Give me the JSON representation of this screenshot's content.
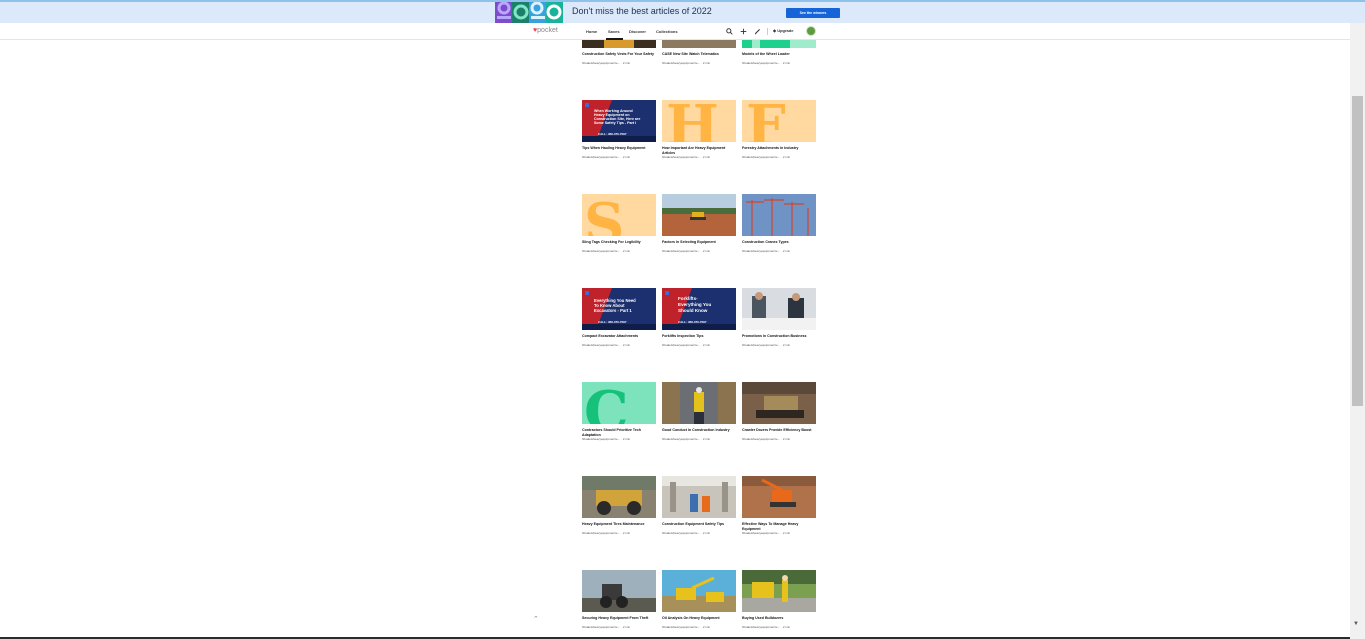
{
  "banner": {
    "text": "Don't miss the best articles of 2022",
    "button_label": "See the winners",
    "art_text": "2022"
  },
  "nav": {
    "logo_mark": "♥",
    "logo_text": "pocket",
    "items": [
      "Home",
      "Saves",
      "Discover",
      "Collections"
    ],
    "active_item": "Saves",
    "upgrade_label": "Upgrade"
  },
  "cards": [
    {
      "title": "Construction Safety Vests For Your Safety",
      "meta": "hbsaleisheavyequipmentre... · 2 min"
    },
    {
      "title": "CASE New Site Watch Telematics",
      "meta": "hbsaleisheavyequipmentre... · 2 min"
    },
    {
      "title": "Models of the Wheel Loader",
      "meta": "hbsaleisheavyequipmentre... · 2 min"
    },
    {
      "title": "Tips When Hauling Heavy Equipment",
      "meta": "hbsaleisheavyequipmentre... · 2 min"
    },
    {
      "title": "How Important Are Heavy Equipment Articles",
      "meta": "hbsaleisheavyequipmentre... · 2 min"
    },
    {
      "title": "Forestry Attachments In Industry",
      "meta": "hbsaleisheavyequipmentre... · 2 min"
    },
    {
      "title": "Sling Tags Checking For Legibility",
      "meta": "hbsaleisheavyequipmentre... · 2 min"
    },
    {
      "title": "Factors In Selecting Equipment",
      "meta": "hbsaleisheavyequipmentre... · 2 min"
    },
    {
      "title": "Construction Cranes Types",
      "meta": "hbsaleisheavyequipmentre... · 2 min"
    },
    {
      "title": "Compact Excavator Attachments",
      "meta": "hbsaleisheavyequipmentre... · 2 min"
    },
    {
      "title": "Forklifts Inspection Tips",
      "meta": "hbsaleisheavyequipmentre... · 2 min"
    },
    {
      "title": "Promotions In Construction Business",
      "meta": "hbsaleisheavyequipmentre... · 2 min"
    },
    {
      "title": "Contractors Should Prioritize Tech Adaptation",
      "meta": "hbsaleisheavyequipmentre... · 2 min"
    },
    {
      "title": "Good Conduct In Construction Industry",
      "meta": "hbsaleisheavyequipmentre... · 2 min"
    },
    {
      "title": "Crawler Dozers Provide Efficiency Boost",
      "meta": "hbsaleisheavyequipmentre... · 2 min"
    },
    {
      "title": "Heavy Equipment Tires Maintenance",
      "meta": "hbsaleisheavyequipmentre... · 2 min"
    },
    {
      "title": "Construction Equipment Safety Tips",
      "meta": "hbsaleisheavyequipmentre... · 2 min"
    },
    {
      "title": "Effective Ways To Manage Heavy Equipment",
      "meta": "hbsaleisheavyequipmentre... · 2 min"
    },
    {
      "title": "Securing Heavy Equipment From Theft",
      "meta": "hbsaleisheavyequipmentre... · 2 min"
    },
    {
      "title": "Oil Analysis On Heavy Equipment",
      "meta": "hbsaleisheavyequipmentre... · 2 min"
    },
    {
      "title": "Buying Used Bulldozers",
      "meta": "hbsaleisheavyequipmentre... · 2 min"
    }
  ],
  "thumb_text": {
    "t3": [
      "When Working Around",
      "Heavy Equipment on",
      "Construction Site, Here are",
      "Some Safety Tips - Part I",
      "CALL: 469-370-7097"
    ],
    "t9": [
      "Everything You Need",
      "To Know About",
      "Excavators - Part 1",
      "CALL: 469-370-7097"
    ],
    "t10": [
      "Forklifts-",
      "Everything You",
      "Should Know",
      "CALL: 469-370-7097"
    ],
    "letters": {
      "h": "H",
      "f": "F",
      "s": "S",
      "c": "C"
    }
  },
  "colors": {
    "brand": "#ef4056",
    "banner_bg": "#dce9fa",
    "button": "#1565d8",
    "peach": "#ffd9a0",
    "orange_letter": "#ffb443",
    "mint": "#7ce3bd",
    "mint_letter": "#16c27a"
  }
}
